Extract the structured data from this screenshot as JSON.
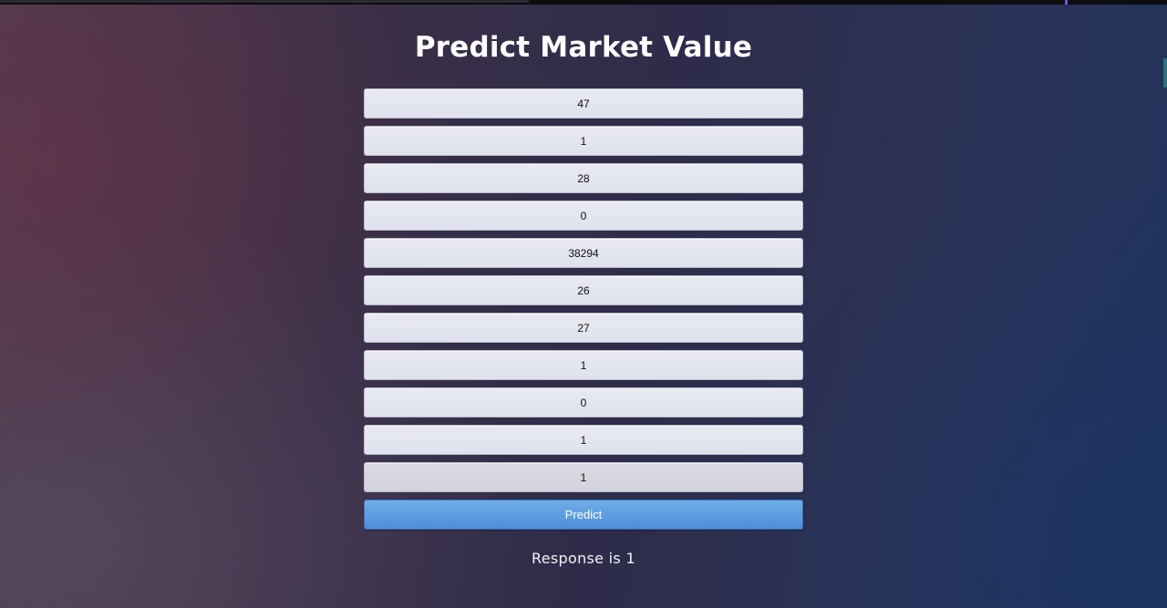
{
  "page": {
    "title": "Predict Market Value"
  },
  "form": {
    "fields": [
      {
        "value": "47"
      },
      {
        "value": "1"
      },
      {
        "value": "28"
      },
      {
        "value": "0"
      },
      {
        "value": "38294"
      },
      {
        "value": "26"
      },
      {
        "value": "27"
      },
      {
        "value": "1"
      },
      {
        "value": "0"
      },
      {
        "value": "1"
      },
      {
        "value": "1"
      }
    ],
    "submit_label": "Predict"
  },
  "result": {
    "text": "Response is 1"
  },
  "colors": {
    "button_accent": "#5b9be0",
    "title_text": "#ffffff",
    "input_background": "#e3e5ef"
  }
}
